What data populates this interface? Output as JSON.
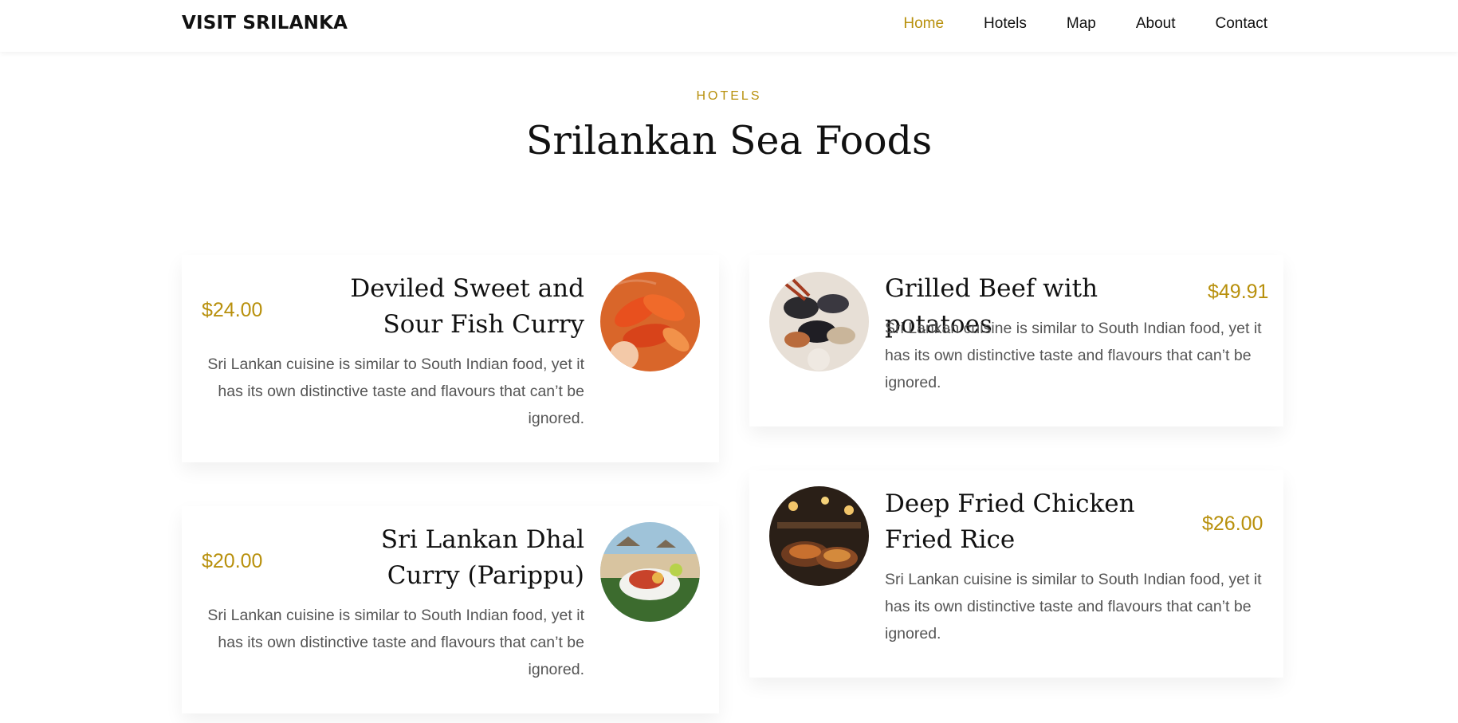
{
  "nav": {
    "brand": "VISIT SRILANKA",
    "links": [
      "Home",
      "Hotels",
      "Map",
      "About",
      "Contact"
    ]
  },
  "section": {
    "eyebrow": "HOTELS",
    "title": "Srilankan Sea Foods"
  },
  "menu": [
    {
      "title": "Deviled Sweet and Sour Fish Curry",
      "price": "$24.00",
      "desc": "Sri Lankan cuisine is similar to South Indian food, yet it has its own distinctive taste and flavours that can’t be ignored."
    },
    {
      "title": "Grilled Beef with potatoes",
      "price": "$49.91",
      "desc": "Sri Lankan cuisine is similar to South Indian food, yet it has its own distinctive taste and flavours that can’t be ignored."
    },
    {
      "title": "Sri Lankan Dhal Curry (Parippu)",
      "price": "$20.00",
      "desc": "Sri Lankan cuisine is similar to South Indian food, yet it has its own distinctive taste and flavours that can’t be ignored."
    },
    {
      "title": "Deep Fried Chicken Fried Rice",
      "price": "$26.00",
      "desc": "Sri Lankan cuisine is similar to South Indian food, yet it has its own distinctive taste and flavours that can’t be ignored."
    }
  ],
  "colors": {
    "accent": "#b8900c",
    "text": "#111111",
    "muted": "#555555"
  }
}
